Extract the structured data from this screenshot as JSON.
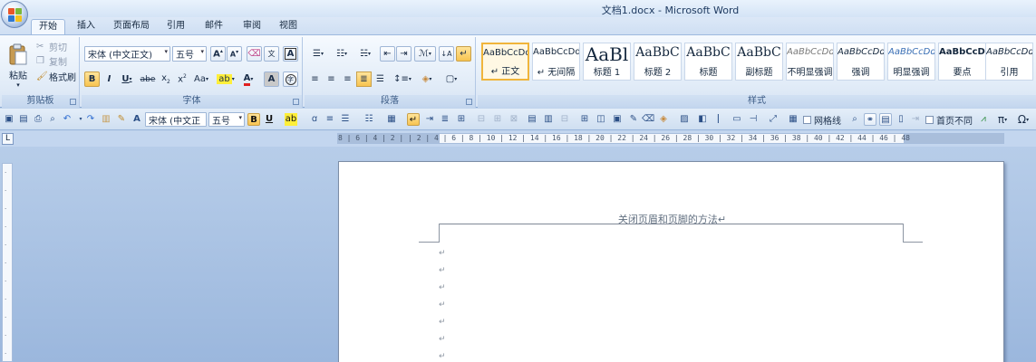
{
  "window": {
    "title": "文档1.docx - Microsoft Word"
  },
  "tabs": [
    "开始",
    "插入",
    "页面布局",
    "引用",
    "邮件",
    "审阅",
    "视图"
  ],
  "clipboard": {
    "paste": "粘贴",
    "cut": "剪切",
    "copy": "复制",
    "format_painter": "格式刷",
    "group": "剪贴板"
  },
  "font": {
    "name": "宋体 (中文正文)",
    "size": "五号",
    "group": "字体"
  },
  "paragraph": {
    "group": "段落"
  },
  "styles": {
    "group": "样式",
    "items": [
      {
        "sample": "AaBbCcDd",
        "name": "↵ 正文"
      },
      {
        "sample": "AaBbCcDd",
        "name": "↵ 无间隔"
      },
      {
        "sample": "AaBl",
        "name": "标题 1"
      },
      {
        "sample": "AaBbC",
        "name": "标题 2"
      },
      {
        "sample": "AaBbC",
        "name": "标题"
      },
      {
        "sample": "AaBbC",
        "name": "副标题"
      },
      {
        "sample": "AaBbCcDd",
        "name": "不明显强调"
      },
      {
        "sample": "AaBbCcDd",
        "name": "强调"
      },
      {
        "sample": "AaBbCcDd",
        "name": "明显强调"
      },
      {
        "sample": "AaBbCcDd",
        "name": "要点"
      },
      {
        "sample": "AaBbCcDd",
        "name": "引用"
      }
    ]
  },
  "qat": {
    "font_name": "宋体 (中文正",
    "font_size": "五号",
    "gridlines": "网格线",
    "first_page_different": "首页不同",
    "pi": "π",
    "omega": "Ω"
  },
  "ruler": {
    "text": "8 | 6 | 4 | 2 |   | 2 | 4 | 6 | 8 | 10 | 12 | 14 | 16 | 18 | 20 | 22 | 24 | 26 | 28 | 30 | 32 | 34 | 36 | 38 | 40 | 42 | 44 | 46 | 48"
  },
  "document": {
    "header_text": "关闭页眉和页脚的方法↵",
    "para_mark": "↵"
  }
}
